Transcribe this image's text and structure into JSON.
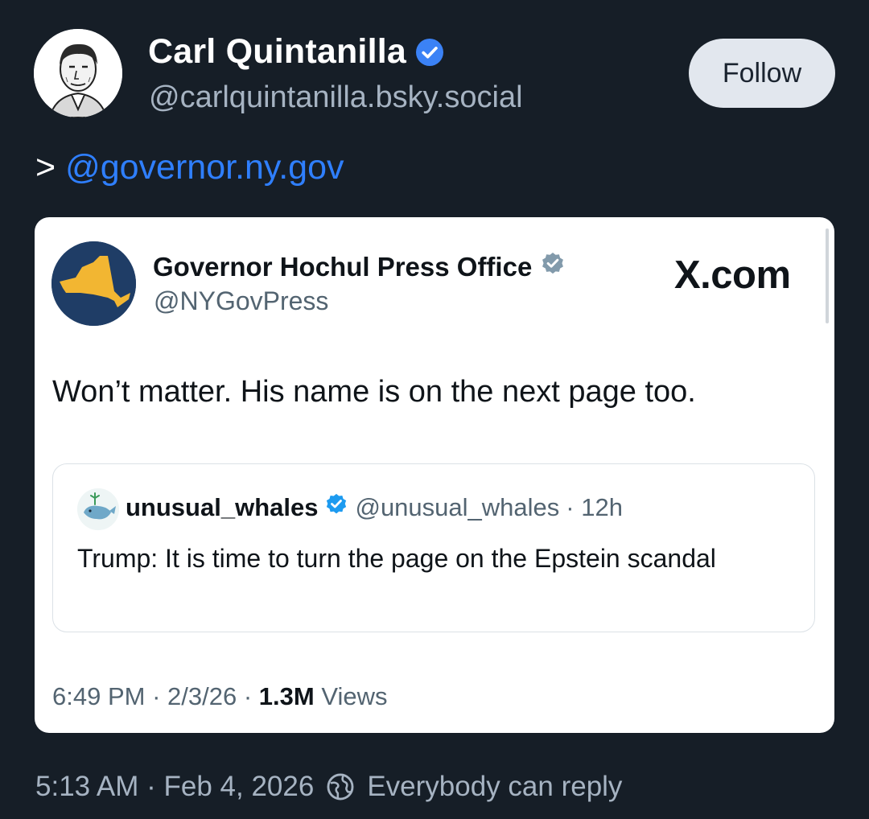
{
  "author": {
    "name": "Carl Quintanilla",
    "handle": "@carlquintanilla.bsky.social",
    "verified": true,
    "verified_color": "#3b82f6"
  },
  "follow_button": {
    "label": "Follow"
  },
  "post": {
    "prefix": ">",
    "mention": "@governor.ny.gov",
    "link_color": "#2f7fff"
  },
  "embed": {
    "source": "X.com",
    "author": {
      "name": "Governor Hochul Press Office",
      "handle": "@NYGovPress",
      "verified_color": "#829aab"
    },
    "text": "Won’t matter. His name is on the next page too.",
    "quoted": {
      "name": "unusual_whales",
      "handle": "@unusual_whales",
      "time": "· 12h",
      "text": "Trump: It is time to turn the page on the Epstein scandal",
      "verified_color": "#1d9bf0"
    },
    "meta": {
      "time": "6:49 PM",
      "date": "2/3/26",
      "views_count": "1.3M",
      "views_label": "Views"
    }
  },
  "footer": {
    "timestamp": "5:13 AM · Feb 4, 2026",
    "reply_setting": "Everybody can reply"
  },
  "colors": {
    "background": "#161e27",
    "muted_text": "#a6b3c2",
    "card_background": "#ffffff"
  }
}
